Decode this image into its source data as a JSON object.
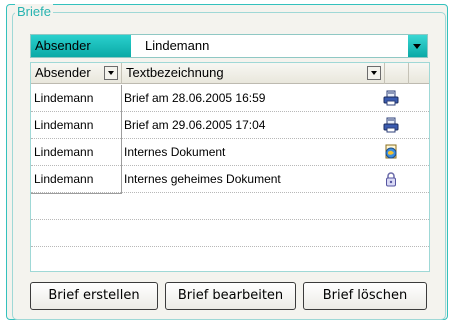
{
  "group": {
    "title": "Briefe"
  },
  "filter": {
    "label": "Absender",
    "value": "Lindemann"
  },
  "columns": {
    "sender": "Absender",
    "description": "Textbezeichnung"
  },
  "rows": [
    {
      "sender": "Lindemann",
      "description": "Brief am 28.06.2005 16:59",
      "icon": "document-printer-icon"
    },
    {
      "sender": "Lindemann",
      "description": "Brief am 29.06.2005 17:04",
      "icon": "document-printer-icon"
    },
    {
      "sender": "Lindemann",
      "description": "Internes Dokument",
      "icon": "globe-document-icon"
    },
    {
      "sender": "Lindemann",
      "description": "Internes geheimes Dokument",
      "icon": "padlock-icon"
    }
  ],
  "buttons": {
    "create": "Brief erstellen",
    "edit": "Brief bearbeiten",
    "delete": "Brief löschen"
  },
  "colors": {
    "accent": "#27b3b0",
    "panel": "#f4f3ee"
  }
}
